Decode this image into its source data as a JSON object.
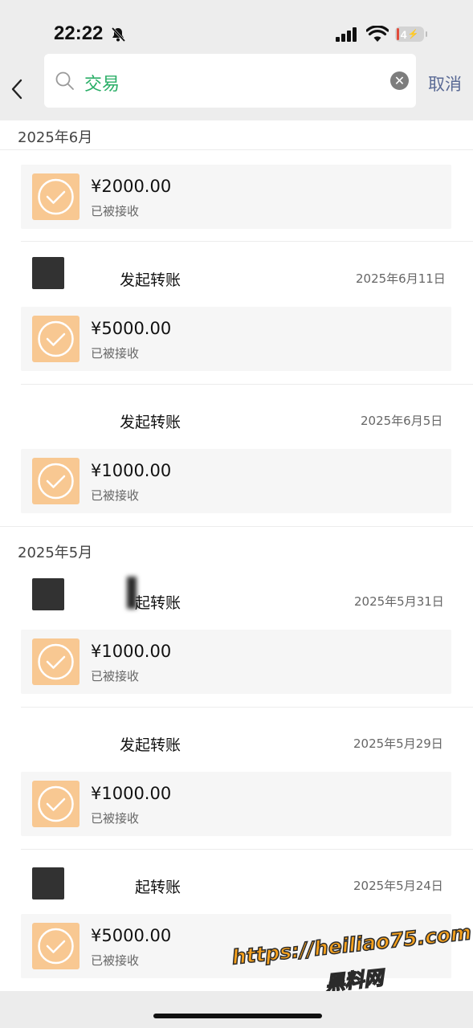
{
  "status_bar": {
    "time": "22:22",
    "battery": "4"
  },
  "search": {
    "query": "交易",
    "cancel": "取消"
  },
  "sections": [
    {
      "month": "2025年6月"
    },
    {
      "month": "2025年5月"
    }
  ],
  "records": [
    {
      "initiated": "",
      "date": "",
      "amount": "¥2000.00",
      "status": "已被接收"
    },
    {
      "initiated": "发起转账",
      "date": "2025年6月11日",
      "amount": "¥5000.00",
      "status": "已被接收"
    },
    {
      "initiated": "发起转账",
      "date": "2025年6月5日",
      "amount": "¥1000.00",
      "status": "已被接收"
    },
    {
      "initiated": "起转账",
      "date": "2025年5月31日",
      "amount": "¥1000.00",
      "status": "已被接收"
    },
    {
      "initiated": "发起转账",
      "date": "2025年5月29日",
      "amount": "¥1000.00",
      "status": "已被接收"
    },
    {
      "initiated": "起转账",
      "date": "2025年5月24日",
      "amount": "¥5000.00",
      "status": "已被接收"
    }
  ],
  "watermark": {
    "line1": "https://heiliao75.com",
    "line2": "黑料网"
  },
  "icons": {
    "back": "chevron-left-icon",
    "search": "magnifier-icon",
    "clear": "close-circle-icon",
    "transfer": "check-circle-icon",
    "bell": "bell-slash-icon"
  },
  "colors": {
    "accent_green": "#2aae67",
    "icon_orange": "#f8c892",
    "cancel_blue": "#5a6a95"
  }
}
